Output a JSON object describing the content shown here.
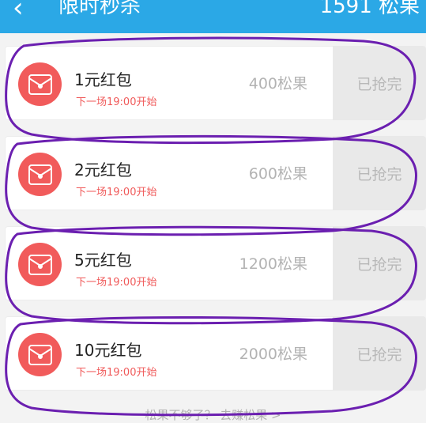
{
  "header": {
    "back_icon": "chevron-left-icon",
    "title": "限时秒杀",
    "balance": "1591 松果"
  },
  "items": [
    {
      "name": "1元红包",
      "schedule": "下一场19:00开始",
      "price": "400松果",
      "action": "已抢完"
    },
    {
      "name": "2元红包",
      "schedule": "下一场19:00开始",
      "price": "600松果",
      "action": "已抢完"
    },
    {
      "name": "5元红包",
      "schedule": "下一场19:00开始",
      "price": "1200松果",
      "action": "已抢完"
    },
    {
      "name": "10元红包",
      "schedule": "下一场19:00开始",
      "price": "2000松果",
      "action": "已抢完"
    }
  ],
  "footer": {
    "link": "松果不够了？ 去赚松果 >"
  },
  "colors": {
    "header": "#2ba8e6",
    "accent": "#f05a5a",
    "annotation": "#6b1fb0"
  }
}
